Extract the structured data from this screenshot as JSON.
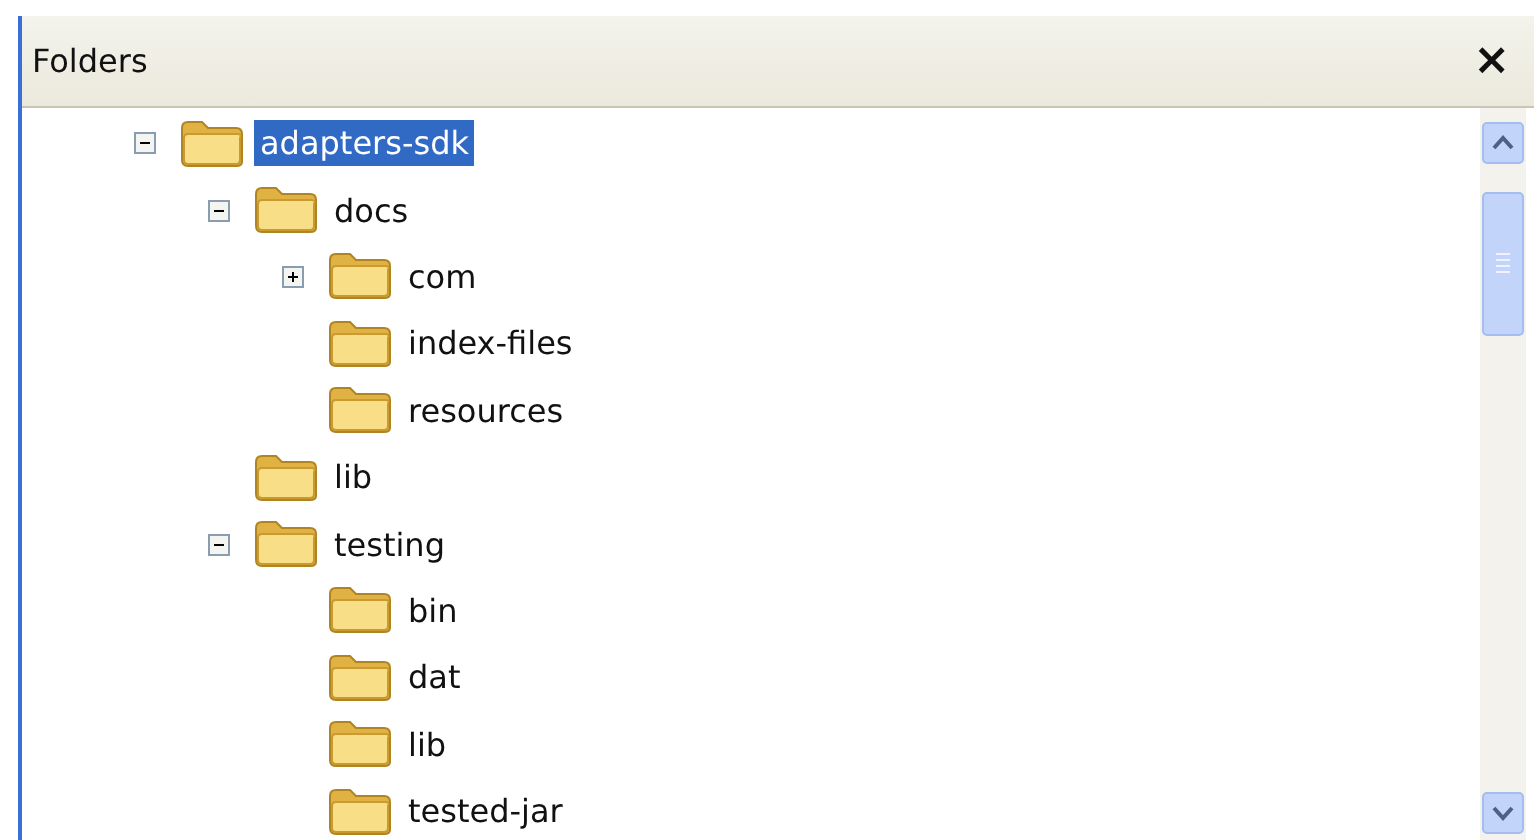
{
  "panel": {
    "title": "Folders",
    "close": "×"
  },
  "tree": [
    {
      "label": "adapters-sdk",
      "selected": true,
      "expanded": true,
      "children": [
        {
          "label": "docs",
          "selected": false,
          "expanded": true,
          "children": [
            {
              "label": "com",
              "selected": false,
              "expanded": false
            },
            {
              "label": "index-files",
              "selected": false
            },
            {
              "label": "resources",
              "selected": false
            }
          ]
        },
        {
          "label": "lib",
          "selected": false
        },
        {
          "label": "testing",
          "selected": false,
          "expanded": true,
          "children": [
            {
              "label": "bin",
              "selected": false
            },
            {
              "label": "dat",
              "selected": false
            },
            {
              "label": "lib",
              "selected": false
            },
            {
              "label": "tested-jar",
              "selected": false
            }
          ]
        }
      ]
    }
  ]
}
